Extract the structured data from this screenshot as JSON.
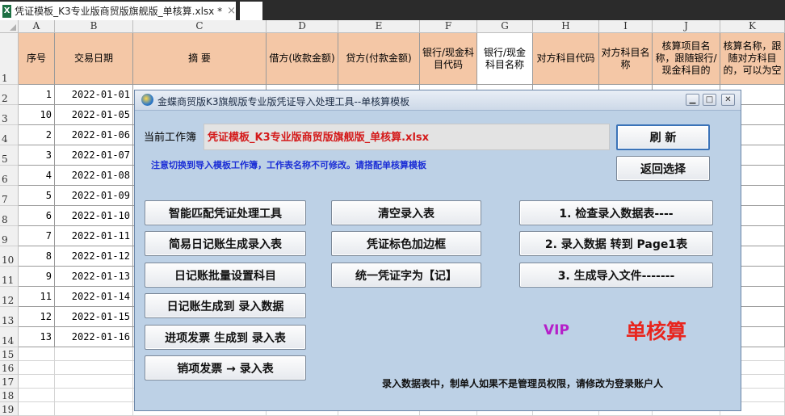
{
  "tabs": {
    "active_title": "凭证模板_K3专业版商贸版旗舰版_单核算.xlsx *",
    "file_icon": "excel-icon",
    "close_glyph": "×"
  },
  "columns": [
    "A",
    "B",
    "C",
    "D",
    "E",
    "F",
    "G",
    "H",
    "I",
    "J",
    "K"
  ],
  "headers": [
    "序号",
    "交易日期",
    "摘 要",
    "借方(收款金额)",
    "贷方(付款金额)",
    "银行/现金科目代码",
    "银行/现金科目名称",
    "对方科目代码",
    "对方科目名称",
    "核算项目名称，跟随银行/现金科目的",
    "核算名称，跟随对方科目的，可以为空"
  ],
  "row_numbers": [
    "1",
    "2",
    "3",
    "4",
    "5",
    "6",
    "7",
    "8",
    "9",
    "10",
    "11",
    "12",
    "13",
    "14",
    "15",
    "16",
    "17",
    "18",
    "19"
  ],
  "rows": [
    {
      "seq": "1",
      "date": "2022-01-01"
    },
    {
      "seq": "10",
      "date": "2022-01-05"
    },
    {
      "seq": "2",
      "date": "2022-01-06"
    },
    {
      "seq": "3",
      "date": "2022-01-07"
    },
    {
      "seq": "4",
      "date": "2022-01-08"
    },
    {
      "seq": "5",
      "date": "2022-01-09"
    },
    {
      "seq": "6",
      "date": "2022-01-10"
    },
    {
      "seq": "7",
      "date": "2022-01-11"
    },
    {
      "seq": "8",
      "date": "2022-01-12"
    },
    {
      "seq": "9",
      "date": "2022-01-13"
    },
    {
      "seq": "11",
      "date": "2022-01-14"
    },
    {
      "seq": "12",
      "date": "2022-01-15"
    },
    {
      "seq": "13",
      "date": "2022-01-16"
    }
  ],
  "dialog": {
    "title": "金蝶商贸版K3旗舰版专业版凭证导入处理工具--单核算模板",
    "minimize": "▁",
    "maximize": "□",
    "close": "✕",
    "workbook_label": "当前工作簿",
    "workbook_value": "凭证模板_K3专业版商贸版旗舰版_单核算.xlsx",
    "note": "注意切换到导入模板工作簿，工作表名称不可修改。请搭配单核算模板",
    "refresh": "刷 新",
    "back": "返回选择",
    "buttons_left": [
      "智能匹配凭证处理工具",
      "简易日记账生成录入表",
      "日记账批量设置科目",
      "日记账生成到 录入数据",
      "进项发票 生成到 录入表",
      "销项发票 → 录入表"
    ],
    "buttons_mid": [
      "清空录入表",
      "凭证标色加边框",
      "统一凭证字为【记】"
    ],
    "buttons_right": [
      "1. 检查录入数据表----",
      "2. 录入数据 转到 Page1表",
      "3. 生成导入文件-------"
    ],
    "vip": "VIP",
    "mode": "单核算",
    "footer": "录入数据表中，制单人如果不是管理员权限，请修改为登录账户人"
  }
}
